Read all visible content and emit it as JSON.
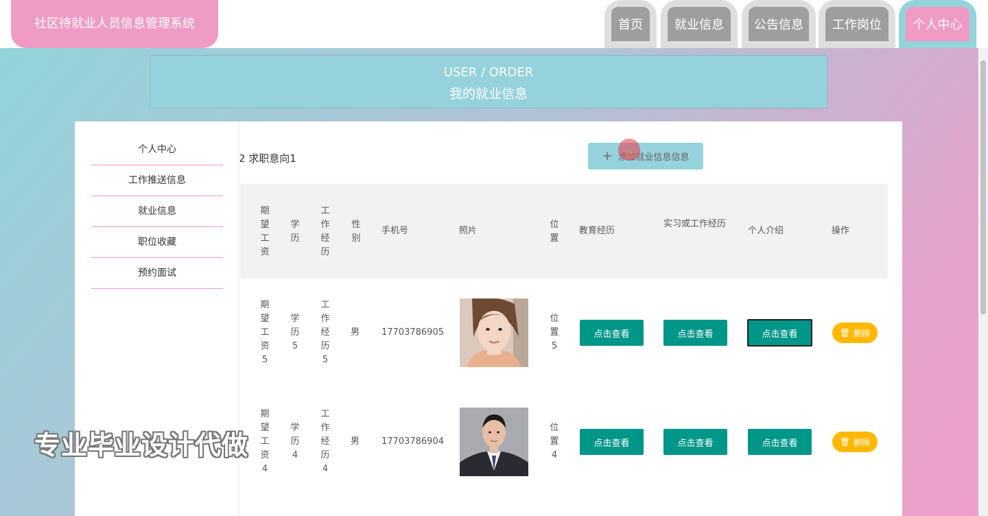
{
  "header": {
    "brand": "社区待就业人员信息管理系统",
    "nav": [
      {
        "label": "首页"
      },
      {
        "label": "就业信息"
      },
      {
        "label": "公告信息"
      },
      {
        "label": "工作岗位"
      },
      {
        "label": "个人中心"
      }
    ]
  },
  "banner": {
    "en": "USER / ORDER",
    "cn": "我的就业信息"
  },
  "sidebar": {
    "items": [
      {
        "label": "个人中心"
      },
      {
        "label": "工作推送信息"
      },
      {
        "label": "就业信息"
      },
      {
        "label": "职位收藏"
      },
      {
        "label": "预约面试"
      }
    ]
  },
  "content": {
    "crumb": "2  求职意向1",
    "add_button": "添加就业信息信息",
    "table": {
      "headers": {
        "salary": "期望工资",
        "education": "学历",
        "experience": "工作经历",
        "gender": "性别",
        "phone": "手机号",
        "photo": "照片",
        "location": "位置",
        "edu_history": "教育经历",
        "work_history": "实习或工作经历",
        "intro": "个人介绍",
        "actions": "操作"
      },
      "rows": [
        {
          "salary": "期望工资5",
          "education": "学历5",
          "experience": "工作经历5",
          "gender": "男",
          "phone": "17703786905",
          "location": "位置5",
          "edu_btn": "点击查看",
          "work_btn": "点击查看",
          "intro_btn": "点击查看",
          "delete_btn": "删除"
        },
        {
          "salary": "期望工资4",
          "education": "学历4",
          "experience": "工作经历4",
          "gender": "男",
          "phone": "17703786904",
          "location": "位置4",
          "edu_btn": "点击查看",
          "work_btn": "点击查看",
          "intro_btn": "点击查看",
          "delete_btn": "删除"
        }
      ]
    }
  },
  "watermark": "专业毕业设计代做",
  "colors": {
    "pink": "#ef9bc4",
    "teal": "#95d2db",
    "green_button": "#009688",
    "delete_button": "#ffb800"
  }
}
